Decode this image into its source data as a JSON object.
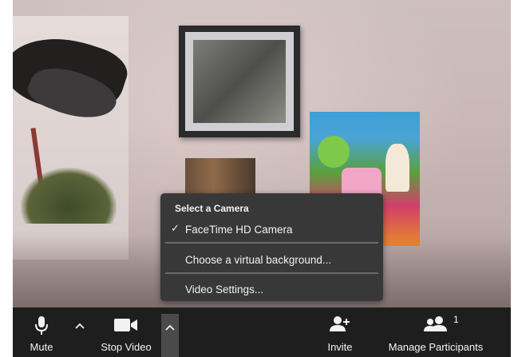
{
  "camera_menu": {
    "header": "Select a Camera",
    "items": [
      {
        "label": "FaceTime HD Camera",
        "checked": true
      },
      {
        "label": "Choose a virtual background..."
      },
      {
        "label": "Video Settings..."
      }
    ],
    "check_glyph": "✓"
  },
  "toolbar": {
    "mute_label": "Mute",
    "mute_icon": "microphone-icon",
    "audio_caret_icon": "chevron-up-icon",
    "video_label": "Stop Video",
    "video_icon": "video-camera-icon",
    "video_caret_icon": "chevron-up-icon",
    "invite_label": "Invite",
    "invite_icon": "add-person-icon",
    "participants_label": "Manage Participants",
    "participants_icon": "people-icon",
    "participants_count": "1"
  },
  "colors": {
    "toolbar_bg": "#1e1e1e",
    "menu_bg": "#383838",
    "caret_active_bg": "#4a4a4a"
  }
}
